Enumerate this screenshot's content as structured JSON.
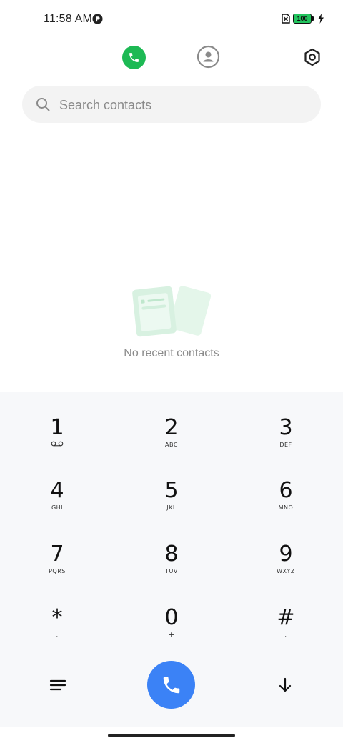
{
  "status_bar": {
    "time": "11:58 AM",
    "battery_level": "100",
    "icons": [
      "notification-p-icon",
      "sim-off-icon",
      "battery-icon",
      "charging-bolt-icon"
    ]
  },
  "top_bar": {
    "tabs": [
      {
        "name": "recents",
        "icon": "phone-icon",
        "active": true,
        "active_color": "#1db954"
      },
      {
        "name": "contacts",
        "icon": "person-icon",
        "active": false
      }
    ],
    "settings_icon": "gear-icon"
  },
  "search": {
    "placeholder": "Search contacts",
    "value": ""
  },
  "empty_state": {
    "icon": "contact-cards-icon",
    "text": "No recent contacts"
  },
  "dialpad": {
    "keys": [
      {
        "digit": "1",
        "letters": "",
        "sub_icon": "voicemail-icon"
      },
      {
        "digit": "2",
        "letters": "ABC"
      },
      {
        "digit": "3",
        "letters": "DEF"
      },
      {
        "digit": "4",
        "letters": "GHI"
      },
      {
        "digit": "5",
        "letters": "JKL"
      },
      {
        "digit": "6",
        "letters": "MNO"
      },
      {
        "digit": "7",
        "letters": "PQRS"
      },
      {
        "digit": "8",
        "letters": "TUV"
      },
      {
        "digit": "9",
        "letters": "WXYZ"
      },
      {
        "digit": "*",
        "letters": ","
      },
      {
        "digit": "0",
        "letters": "+"
      },
      {
        "digit": "#",
        "letters": ";"
      }
    ],
    "actions": {
      "menu_icon": "menu-icon",
      "call_icon": "phone-icon",
      "call_color": "#3b82f6",
      "collapse_icon": "arrow-down-icon"
    }
  }
}
